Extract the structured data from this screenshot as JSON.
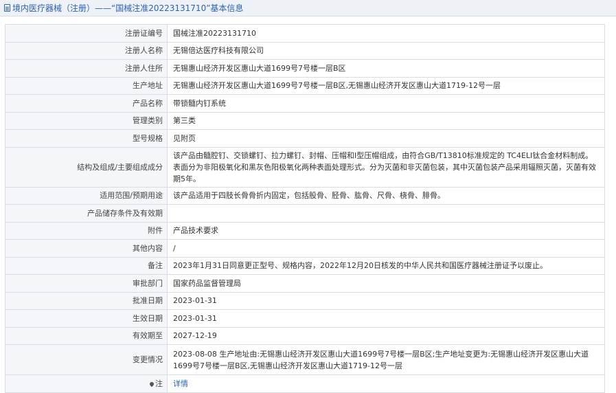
{
  "header": {
    "title": "境内医疗器械（注册）——“国械注准20223131710”基本信息"
  },
  "rows": [
    {
      "label": "注册证编号",
      "value": "国械注准20223131710"
    },
    {
      "label": "注册人名称",
      "value": "无锡倍达医疗科技有限公司"
    },
    {
      "label": "注册人住所",
      "value": "无锡惠山经济开发区惠山大道1699号7号楼一层B区"
    },
    {
      "label": "生产地址",
      "value": "无锡惠山经济开发区惠山大道1699号7号楼一层B区,无锡惠山经济开发区惠山大道1719-12号一层"
    },
    {
      "label": "产品名称",
      "value": "带锁髓内钉系统"
    },
    {
      "label": "管理类别",
      "value": "第三类"
    },
    {
      "label": "型号规格",
      "value": "见附页"
    },
    {
      "label": "结构及组成/主要组成成分",
      "value": "该产品由髓腔钉、交锁螺钉、拉力螺钉、封帽、压帽和Ⅰ型压帽组成，由符合GB/T13810标准规定的 TC4ELI钛合金材料制成。表面分为非阳极氧化和黑灰色阳极氧化两种表面处理形式。分为灭菌和非灭菌包装，其中灭菌包装产品采用辐照灭菌，灭菌有效期5年。"
    },
    {
      "label": "适用范围/预期用途",
      "value": "该产品适用于四肢长骨骨折内固定，包括股骨、胫骨、肱骨、尺骨、桡骨、腓骨。"
    },
    {
      "label": "产品储存条件及有效期",
      "value": ""
    },
    {
      "label": "附件",
      "value": "产品技术要求"
    },
    {
      "label": "其他内容",
      "value": "/"
    },
    {
      "label": "备注",
      "value": "2023年1月31日同意更正型号、规格内容，2022年12月20日核发的中华人民共和国医疗器械注册证予以废止。"
    },
    {
      "label": "审批部门",
      "value": "国家药品监督管理局"
    },
    {
      "label": "批准日期",
      "value": "2023-01-31"
    },
    {
      "label": "生效日期",
      "value": "2023-01-31"
    },
    {
      "label": "有效期至",
      "value": "2027-12-19"
    },
    {
      "label": "变更情况",
      "value": "2023-08-08 生产地址由:无锡惠山经济开发区惠山大道1699号7号楼一层B区;生产地址变更为:无锡惠山经济开发区惠山大道1699号7号楼一层B区,无锡惠山经济开发区惠山大道1719-12号一层"
    }
  ],
  "note": {
    "label": "注",
    "icon": "pin-icon",
    "link": "详情"
  }
}
